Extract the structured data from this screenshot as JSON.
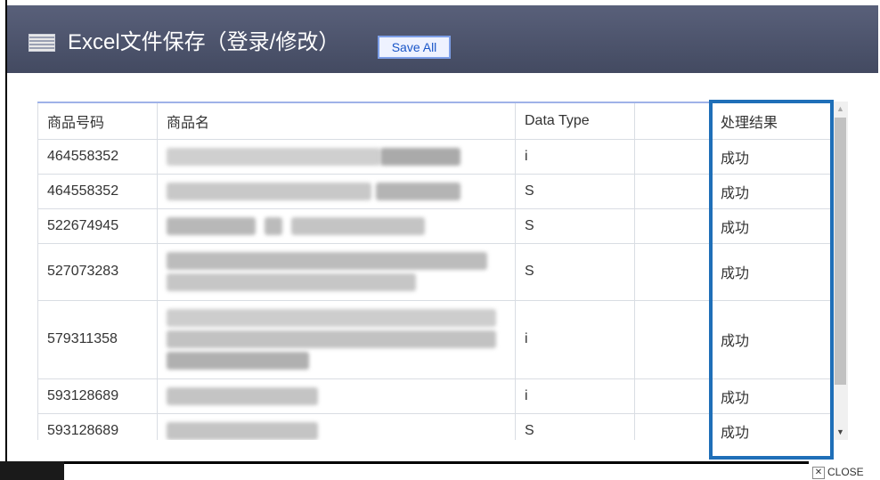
{
  "header": {
    "title": "Excel文件保存（登录/修改）",
    "save_all_label": "Save All",
    "icon": "spreadsheet-icon"
  },
  "table": {
    "columns": [
      "商品号码",
      "商品名",
      "Data Type",
      "",
      "处理结果"
    ],
    "rows": [
      {
        "code": "464558352",
        "name": "",
        "type": "i",
        "extra": "",
        "result": "成功"
      },
      {
        "code": "464558352",
        "name": "",
        "type": "S",
        "extra": "",
        "result": "成功"
      },
      {
        "code": "522674945",
        "name": "",
        "type": "S",
        "extra": "",
        "result": "成功"
      },
      {
        "code": "527073283",
        "name": "",
        "type": "S",
        "extra": "",
        "result": "成功"
      },
      {
        "code": "579311358",
        "name": "",
        "type": "i",
        "extra": "",
        "result": "成功"
      },
      {
        "code": "593128689",
        "name": "",
        "type": "i",
        "extra": "",
        "result": "成功"
      },
      {
        "code": "593128689",
        "name": "",
        "type": "S",
        "extra": "",
        "result": "成功"
      }
    ]
  },
  "footer": {
    "close_label": "CLOSE"
  },
  "colors": {
    "header_bg": "#4b5168",
    "highlight": "#1f6fb8",
    "save_button_text": "#1a56c8"
  }
}
